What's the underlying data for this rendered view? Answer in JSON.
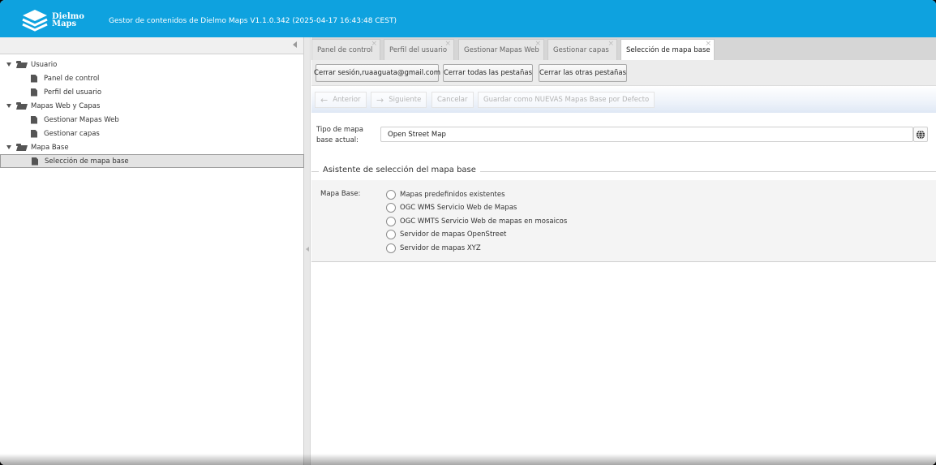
{
  "header": {
    "logo_text_line1": "Dielmo",
    "logo_text_line2": "Maps",
    "title": "Gestor de contenidos de Dielmo Maps V1.1.0.342 (2025-04-17 16:43:48 CEST)"
  },
  "tree": {
    "items": [
      {
        "label": "Usuario",
        "type": "folder"
      },
      {
        "label": "Panel de control",
        "type": "doc"
      },
      {
        "label": "Perfil del usuario",
        "type": "doc"
      },
      {
        "label": "Mapas Web y Capas",
        "type": "folder"
      },
      {
        "label": "Gestionar Mapas Web",
        "type": "doc"
      },
      {
        "label": "Gestionar capas",
        "type": "doc"
      },
      {
        "label": "Mapa Base",
        "type": "folder"
      },
      {
        "label": "Selección de mapa base",
        "type": "doc",
        "selected": true
      }
    ]
  },
  "tabs": [
    {
      "label": "Panel de control"
    },
    {
      "label": "Perfil del usuario"
    },
    {
      "label": "Gestionar Mapas Web"
    },
    {
      "label": "Gestionar capas"
    },
    {
      "label": "Selección de mapa base",
      "active": true
    }
  ],
  "tab_close_glyph": "×",
  "actions": {
    "logout": "Cerrar sesión,ruaaguata@gmail.com",
    "close_all": "Cerrar todas las pestañas",
    "close_others": "Cerrar las otras pestañas"
  },
  "wizard": {
    "prev": "Anterior",
    "next": "Siguiente",
    "cancel": "Cancelar",
    "save_default": "Guardar como NUEVAS Mapas Base por Defecto",
    "prev_arrow": "←",
    "next_arrow": "→"
  },
  "current_map": {
    "label": "Tipo de mapa base actual:",
    "value": "Open Street Map"
  },
  "assistant": {
    "legend": "Asistente de selección del mapa base",
    "field_label": "Mapa Base:",
    "options": [
      "Mapas predefinidos existentes",
      "OGC WMS Servicio Web de Mapas",
      "OGC WMTS Servicio Web de mapas en mosaicos",
      "Servidor de mapas OpenStreet",
      "Servidor de mapas XYZ"
    ]
  },
  "colors": {
    "header": "#0ea2df",
    "selected_row": "#e3e3e3"
  }
}
